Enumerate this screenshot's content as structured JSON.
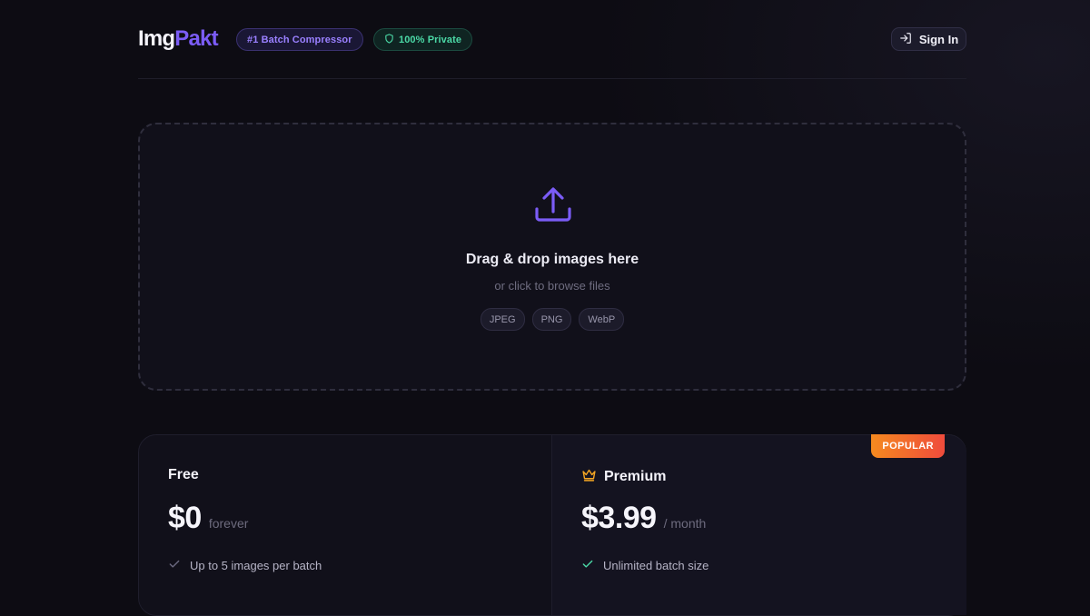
{
  "header": {
    "logo_part1": "Img",
    "logo_part2": "Pakt",
    "badge_batch": "#1 Batch Compressor",
    "badge_private": "100% Private",
    "signin_label": "Sign In"
  },
  "dropzone": {
    "title": "Drag & drop images here",
    "subtitle": "or click to browse files",
    "formats": [
      "JPEG",
      "PNG",
      "WebP"
    ],
    "icon": "upload-icon"
  },
  "pricing": {
    "plans": [
      {
        "name": "Free",
        "price": "$0",
        "period": "forever",
        "features": [
          "Up to 5 images per batch"
        ]
      },
      {
        "name": "Premium",
        "price": "$3.99",
        "period": "/ month",
        "badge": "POPULAR",
        "features": [
          "Unlimited batch size"
        ]
      }
    ]
  },
  "colors": {
    "background": "#0d0c13",
    "accent": "#7b5cf6",
    "success": "#4bd8a6",
    "popular_gradient": [
      "#f58a1f",
      "#ef4b3c"
    ]
  }
}
